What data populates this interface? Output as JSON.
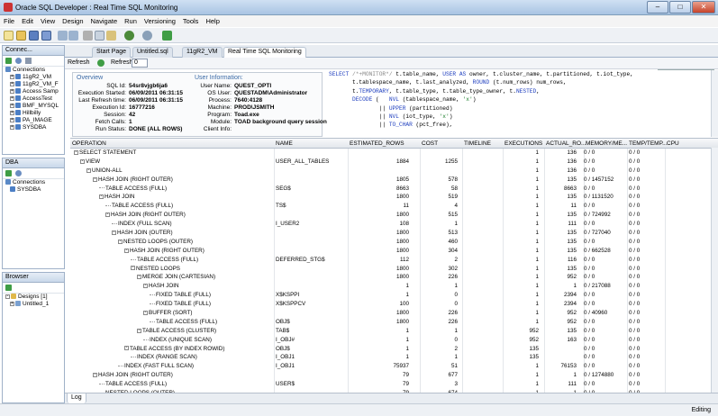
{
  "window": {
    "title": "Oracle SQL Developer : Real Time SQL Monitoring"
  },
  "menu": [
    "File",
    "Edit",
    "View",
    "Design",
    "Navigate",
    "Run",
    "Versioning",
    "Tools",
    "Help"
  ],
  "search_text": "sql",
  "connections_panel": {
    "tab_label": "Connec...",
    "header": "Connections",
    "items": [
      "11gR2_VM",
      "11gR2_VM_F",
      "Access Samp",
      "AccessTest",
      "BMF_MYSQL",
      "Hillbilly",
      "PA_IMAGE",
      "SYSDBA"
    ]
  },
  "dba_panel": {
    "header": "DBA",
    "items": [
      "Connections",
      "SYSDBA"
    ]
  },
  "browser_panel": {
    "header": "Browser",
    "items": [
      "Designs [1]",
      "Untitled_1"
    ]
  },
  "editor_tabs": [
    "Start Page",
    "Untitled.sql",
    "11gR2_VM",
    "Real Time SQL Monitoring"
  ],
  "subbar": {
    "refresh_label": "Refresh",
    "refresh2_label": "Refresh:",
    "refresh_value": "0"
  },
  "overview": {
    "header": "Overview",
    "rows": [
      {
        "k": "SQL Id:",
        "v": "54sr8vjgb6ja6"
      },
      {
        "k": "Execution Started:",
        "v": "06/09/2011 06:31:15"
      },
      {
        "k": "Last Refresh time:",
        "v": "06/09/2011 06:31:15"
      },
      {
        "k": "Execution Id:",
        "v": "16777216"
      },
      {
        "k": "Session:",
        "v": "42"
      },
      {
        "k": "Fetch Calls:",
        "v": "1"
      },
      {
        "k": "Run Status:",
        "v": "DONE (ALL ROWS)"
      }
    ]
  },
  "user_info": {
    "header": "User Information:",
    "rows": [
      {
        "k": "User Name:",
        "v": "QUEST_OPTI"
      },
      {
        "k": "OS User:",
        "v": "QUESTADM\\Administrator"
      },
      {
        "k": "Process:",
        "v": "7640:4128"
      },
      {
        "k": "Machine:",
        "v": "PROD\\JSMITH"
      },
      {
        "k": "Program:",
        "v": "Toad.exe"
      },
      {
        "k": "Module:",
        "v": "TOAD background query session"
      },
      {
        "k": "Client Info:",
        "v": ""
      }
    ]
  },
  "sql_lines": [
    "SELECT /*+MONITOR*/ t.table_name, USER AS owner, t.cluster_name, t.partitioned, t.iot_type,",
    "       t.tablespace_name, t.last_analyzed, ROUND (t.num_rows) num_rows,",
    "       t.TEMPORARY, t.table_type, t.table_type_owner, t.NESTED,",
    "       DECODE (   NVL (tablespace_name, 'x')",
    "               || UPPER (partitioned)",
    "               || NVL (iot_type, 'x')",
    "               || TO_CHAR (pct_free),"
  ],
  "grid": {
    "columns": [
      "OPERATION",
      "NAME",
      "ESTIMATED_ROWS",
      "COST",
      "TIMELINE",
      "EXECUTIONS",
      "ACTUAL_RO...",
      "MEMORY/ME...",
      "TEMP/TEMP...",
      "CPU"
    ],
    "rows": [
      {
        "d": 0,
        "op": "SELECT STATEMENT",
        "name": "",
        "est": "",
        "cost": "",
        "exe": "1",
        "act": "136",
        "mem": "0 / 0",
        "temp": "0 / 0"
      },
      {
        "d": 1,
        "op": "VIEW",
        "name": "USER_ALL_TABLES",
        "est": "1884",
        "cost": "1255",
        "exe": "1",
        "act": "136",
        "mem": "0 / 0",
        "temp": "0 / 0"
      },
      {
        "d": 2,
        "op": "UNION-ALL",
        "name": "",
        "est": "",
        "cost": "",
        "exe": "1",
        "act": "136",
        "mem": "0 / 0",
        "temp": "0 / 0"
      },
      {
        "d": 3,
        "op": "HASH JOIN (RIGHT OUTER)",
        "name": "",
        "est": "1805",
        "cost": "578",
        "exe": "1",
        "act": "135",
        "mem": "0 / 1457152",
        "temp": "0 / 0"
      },
      {
        "d": 4,
        "op": "TABLE ACCESS (FULL)",
        "name": "SEG$",
        "est": "8663",
        "cost": "58",
        "exe": "1",
        "act": "8663",
        "mem": "0 / 0",
        "temp": "0 / 0"
      },
      {
        "d": 4,
        "op": "HASH JOIN",
        "name": "",
        "est": "1800",
        "cost": "519",
        "exe": "1",
        "act": "135",
        "mem": "0 / 1131520",
        "temp": "0 / 0"
      },
      {
        "d": 5,
        "op": "TABLE ACCESS (FULL)",
        "name": "TS$",
        "est": "11",
        "cost": "4",
        "exe": "1",
        "act": "11",
        "mem": "0 / 0",
        "temp": "0 / 0"
      },
      {
        "d": 5,
        "op": "HASH JOIN (RIGHT OUTER)",
        "name": "",
        "est": "1800",
        "cost": "515",
        "exe": "1",
        "act": "135",
        "mem": "0 / 724992",
        "temp": "0 / 0"
      },
      {
        "d": 6,
        "op": "INDEX (FULL SCAN)",
        "name": "I_USER2",
        "est": "108",
        "cost": "1",
        "exe": "1",
        "act": "111",
        "mem": "0 / 0",
        "temp": "0 / 0"
      },
      {
        "d": 6,
        "op": "HASH JOIN (OUTER)",
        "name": "",
        "est": "1800",
        "cost": "513",
        "exe": "1",
        "act": "135",
        "mem": "0 / 727040",
        "temp": "0 / 0"
      },
      {
        "d": 7,
        "op": "NESTED LOOPS (OUTER)",
        "name": "",
        "est": "1800",
        "cost": "460",
        "exe": "1",
        "act": "135",
        "mem": "0 / 0",
        "temp": "0 / 0"
      },
      {
        "d": 8,
        "op": "HASH JOIN (RIGHT OUTER)",
        "name": "",
        "est": "1800",
        "cost": "304",
        "exe": "1",
        "act": "135",
        "mem": "0 / 662528",
        "temp": "0 / 0"
      },
      {
        "d": 9,
        "op": "TABLE ACCESS (FULL)",
        "name": "DEFERRED_STG$",
        "est": "112",
        "cost": "2",
        "exe": "1",
        "act": "116",
        "mem": "0 / 0",
        "temp": "0 / 0"
      },
      {
        "d": 9,
        "op": "NESTED LOOPS",
        "name": "",
        "est": "1800",
        "cost": "302",
        "exe": "1",
        "act": "135",
        "mem": "0 / 0",
        "temp": "0 / 0"
      },
      {
        "d": 10,
        "op": "MERGE JOIN (CARTESIAN)",
        "name": "",
        "est": "1800",
        "cost": "226",
        "exe": "1",
        "act": "952",
        "mem": "0 / 0",
        "temp": "0 / 0"
      },
      {
        "d": 11,
        "op": "HASH JOIN",
        "name": "",
        "est": "1",
        "cost": "1",
        "exe": "1",
        "act": "1",
        "mem": "0 / 217088",
        "temp": "0 / 0"
      },
      {
        "d": 12,
        "op": "FIXED TABLE (FULL)",
        "name": "X$KSPPI",
        "est": "1",
        "cost": "0",
        "exe": "1",
        "act": "2394",
        "mem": "0 / 0",
        "temp": "0 / 0"
      },
      {
        "d": 12,
        "op": "FIXED TABLE (FULL)",
        "name": "X$KSPPCV",
        "est": "100",
        "cost": "0",
        "exe": "1",
        "act": "2394",
        "mem": "0 / 0",
        "temp": "0 / 0"
      },
      {
        "d": 11,
        "op": "BUFFER (SORT)",
        "name": "",
        "est": "1800",
        "cost": "226",
        "exe": "1",
        "act": "952",
        "mem": "0 / 40960",
        "temp": "0 / 0"
      },
      {
        "d": 12,
        "op": "TABLE ACCESS (FULL)",
        "name": "OBJ$",
        "est": "1800",
        "cost": "226",
        "exe": "1",
        "act": "952",
        "mem": "0 / 0",
        "temp": "0 / 0"
      },
      {
        "d": 10,
        "op": "TABLE ACCESS (CLUSTER)",
        "name": "TAB$",
        "est": "1",
        "cost": "1",
        "exe": "952",
        "act": "135",
        "mem": "0 / 0",
        "temp": "0 / 0"
      },
      {
        "d": 11,
        "op": "INDEX (UNIQUE SCAN)",
        "name": "I_OBJ#",
        "est": "1",
        "cost": "0",
        "exe": "952",
        "act": "163",
        "mem": "0 / 0",
        "temp": "0 / 0"
      },
      {
        "d": 8,
        "op": "TABLE ACCESS (BY INDEX ROWID)",
        "name": "OBJ$",
        "est": "1",
        "cost": "2",
        "exe": "135",
        "act": "",
        "mem": "0 / 0",
        "temp": "0 / 0"
      },
      {
        "d": 9,
        "op": "INDEX (RANGE SCAN)",
        "name": "I_OBJ1",
        "est": "1",
        "cost": "1",
        "exe": "135",
        "act": "",
        "mem": "0 / 0",
        "temp": "0 / 0"
      },
      {
        "d": 7,
        "op": "INDEX (FAST FULL SCAN)",
        "name": "I_OBJ1",
        "est": "75937",
        "cost": "51",
        "exe": "1",
        "act": "76153",
        "mem": "0 / 0",
        "temp": "0 / 0"
      },
      {
        "d": 3,
        "op": "HASH JOIN (RIGHT OUTER)",
        "name": "",
        "est": "79",
        "cost": "677",
        "exe": "1",
        "act": "1",
        "mem": "0 / 1274880",
        "temp": "0 / 0"
      },
      {
        "d": 4,
        "op": "TABLE ACCESS (FULL)",
        "name": "USER$",
        "est": "79",
        "cost": "3",
        "exe": "1",
        "act": "111",
        "mem": "0 / 0",
        "temp": "0 / 0"
      },
      {
        "d": 4,
        "op": "NESTED LOOPS (OUTER)",
        "name": "",
        "est": "79",
        "cost": "674",
        "exe": "1",
        "act": "1",
        "mem": "0 / 0",
        "temp": "0 / 0"
      }
    ]
  },
  "bottom_tab": "Log",
  "status": "Editing"
}
